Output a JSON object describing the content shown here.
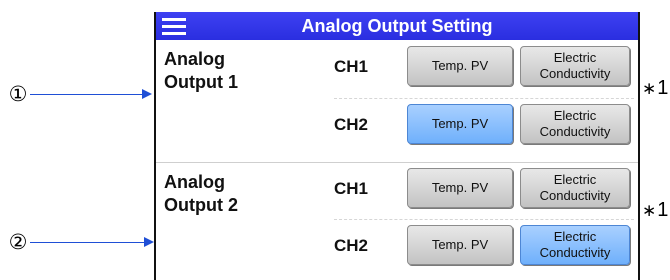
{
  "screen": {
    "title": "Analog Output Setting",
    "menu_icon": "hamburger-menu-icon"
  },
  "outputs": [
    {
      "label_line1": "Analog",
      "label_line2": "Output 1",
      "channels": [
        {
          "name": "CH1",
          "option1": "Temp. PV",
          "option2_line1": "Electric",
          "option2_line2": "Conductivity",
          "selected": "none"
        },
        {
          "name": "CH2",
          "option1": "Temp. PV",
          "option2_line1": "Electric",
          "option2_line2": "Conductivity",
          "selected": "Temp. PV"
        }
      ]
    },
    {
      "label_line1": "Analog",
      "label_line2": "Output 2",
      "channels": [
        {
          "name": "CH1",
          "option1": "Temp. PV",
          "option2_line1": "Electric",
          "option2_line2": "Conductivity",
          "selected": "none"
        },
        {
          "name": "CH2",
          "option1": "Temp. PV",
          "option2_line1": "Electric",
          "option2_line2": "Conductivity",
          "selected": "Electric Conductivity"
        }
      ]
    }
  ],
  "callouts": {
    "first": "①",
    "second": "②"
  },
  "notes": {
    "star": "∗",
    "ref": "1"
  },
  "colors": {
    "title_bar": "#3437ea",
    "selected_button": "#8cc0ff",
    "arrow": "#1f4fd6"
  }
}
